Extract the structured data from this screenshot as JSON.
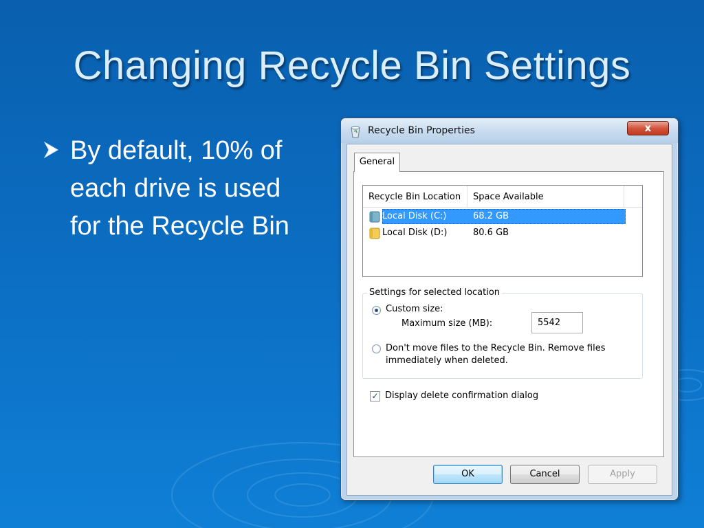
{
  "slide": {
    "title": "Changing Recycle Bin Settings",
    "bullet": "By default, 10% of each drive is used for the Recycle Bin"
  },
  "dialog": {
    "title": "Recycle Bin Properties",
    "close_label": "x",
    "tab_label": "General",
    "list": {
      "columns": [
        "Recycle Bin Location",
        "Space Available"
      ],
      "rows": [
        {
          "location": "Local Disk (C:)",
          "space": "68.2 GB",
          "selected": true
        },
        {
          "location": "Local Disk (D:)",
          "space": "80.6 GB",
          "selected": false
        }
      ]
    },
    "settings": {
      "legend": "Settings for selected location",
      "custom_size_label": "Custom size:",
      "max_size_label": "Maximum size (MB):",
      "max_size_value": "5542",
      "no_move_label": "Don't move files to the Recycle Bin. Remove files immediately when deleted.",
      "selected_option": "custom"
    },
    "confirm_checkbox": {
      "label": "Display delete confirmation dialog",
      "checked": true
    },
    "buttons": {
      "ok": "OK",
      "cancel": "Cancel",
      "apply": "Apply"
    }
  },
  "colors": {
    "background": "#0b6cc0",
    "title_text": "#dbeefc",
    "selection": "#3399ff"
  }
}
